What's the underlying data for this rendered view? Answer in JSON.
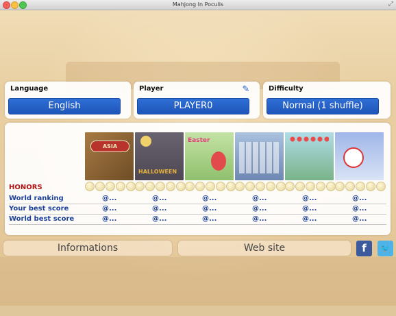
{
  "window": {
    "title": "Mahjong In Poculis"
  },
  "settings": {
    "language": {
      "label": "Language",
      "value": "English"
    },
    "player": {
      "label": "Player",
      "value": "PLAYER0",
      "edit_icon": "edit-player-icon"
    },
    "difficulty": {
      "label": "Difficulty",
      "value": "Normal (1 shuffle)"
    }
  },
  "honors": {
    "title": "HONORS",
    "themes": [
      {
        "name": "asia",
        "badge": "ASIA"
      },
      {
        "name": "halloween",
        "badge": "HALLOWEEN"
      },
      {
        "name": "easter",
        "badge": "Easter"
      },
      {
        "name": "tiles",
        "badge": ""
      },
      {
        "name": "balls",
        "badge": ""
      },
      {
        "name": "christmas",
        "badge": ""
      }
    ],
    "rows": [
      {
        "label": "World ranking",
        "values": [
          "@...",
          "@...",
          "@...",
          "@...",
          "@...",
          "@..."
        ]
      },
      {
        "label": "Your best score",
        "values": [
          "@...",
          "@...",
          "@...",
          "@...",
          "@...",
          "@..."
        ]
      },
      {
        "label": "World best score",
        "values": [
          "@...",
          "@...",
          "@...",
          "@...",
          "@...",
          "@..."
        ]
      }
    ]
  },
  "footer": {
    "informations": "Informations",
    "website": "Web site",
    "facebook_icon": "facebook-icon",
    "twitter_icon": "twitter-icon"
  },
  "colors": {
    "button_blue": "#1e55b8",
    "honors_red": "#b01515",
    "stats_blue": "#1b3f9a"
  }
}
